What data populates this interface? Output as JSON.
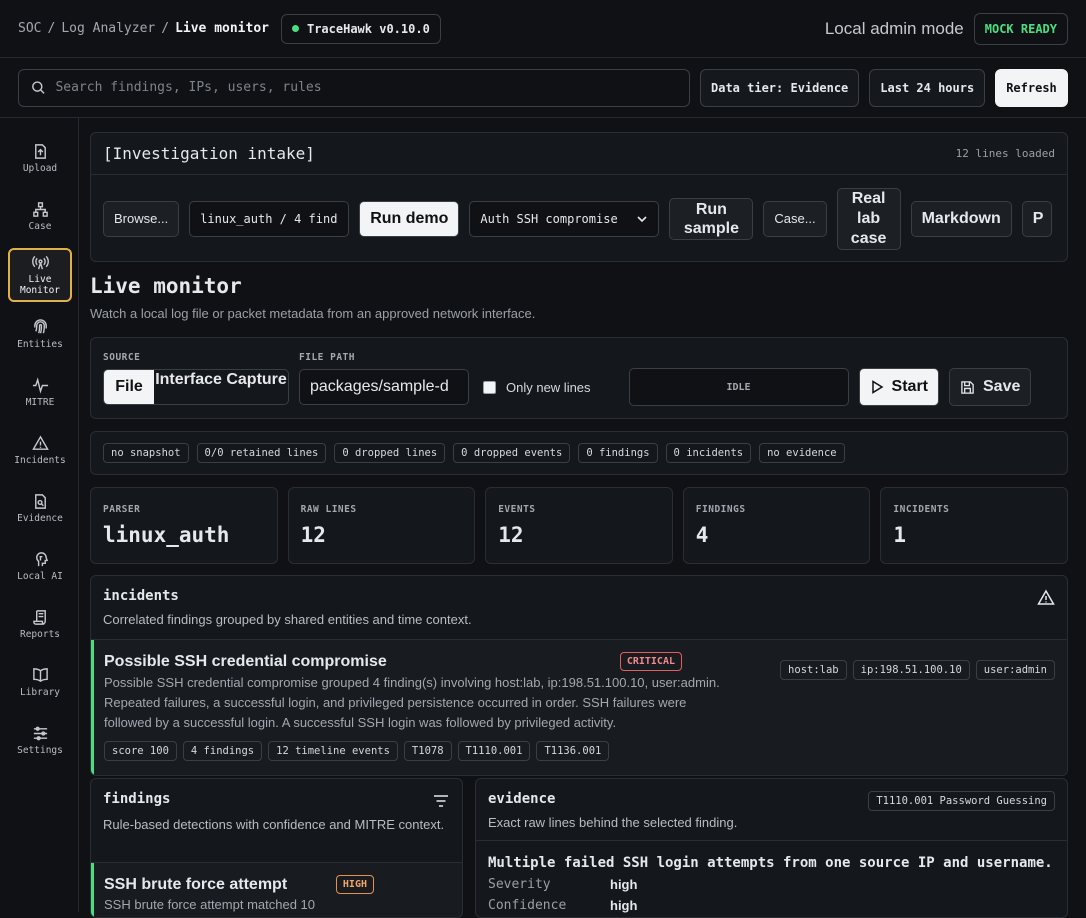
{
  "breadcrumb": {
    "soc": "SOC",
    "sep1": "/",
    "analyzer": "Log Analyzer",
    "sep2": "/",
    "current": "Live monitor"
  },
  "app_version": "TraceHawk v0.10.0",
  "mode_label": "Local admin mode",
  "mock_status": "MOCK READY",
  "search": {
    "placeholder": "Search findings, IPs, users, rules"
  },
  "toolbar": {
    "data_tier": "Data tier: Evidence",
    "time_range": "Last 24 hours",
    "refresh": "Refresh"
  },
  "sidebar": {
    "items": [
      {
        "label": "Upload",
        "icon": "upload-icon"
      },
      {
        "label": "Case",
        "icon": "case-icon"
      },
      {
        "label": "Live\nMonitor",
        "icon": "live-monitor-icon",
        "active": true
      },
      {
        "label": "Entities",
        "icon": "fingerprint-icon"
      },
      {
        "label": "MITRE",
        "icon": "pulse-icon"
      },
      {
        "label": "Incidents",
        "icon": "warning-icon"
      },
      {
        "label": "Evidence",
        "icon": "evidence-icon"
      },
      {
        "label": "Local AI",
        "icon": "brain-icon"
      },
      {
        "label": "Reports",
        "icon": "scroll-icon"
      },
      {
        "label": "Library",
        "icon": "book-icon"
      },
      {
        "label": "Settings",
        "icon": "sliders-icon"
      }
    ]
  },
  "intake": {
    "title": "[Investigation intake]",
    "lines_loaded": "12 lines loaded",
    "browse": "Browse...",
    "sample_field": "linux_auth / 4 find",
    "run_demo": "Run demo",
    "scenario": "Auth SSH compromise",
    "run_sample": "Run sample",
    "case": "Case...",
    "real_lab_case": "Real lab case",
    "markdown": "Markdown",
    "cut_button": "P"
  },
  "live_monitor": {
    "title": "Live monitor",
    "subtitle": "Watch a local log file or packet metadata from an approved network interface.",
    "source_label": "SOURCE",
    "source_file": "File",
    "source_interface": "Interface Capture",
    "file_path_label": "FILE PATH",
    "file_path_value": "packages/sample-d",
    "only_new_lines": "Only new lines",
    "status": "IDLE",
    "start": "Start",
    "save": "Save"
  },
  "status_chips": [
    "no snapshot",
    "0/0 retained lines",
    "0 dropped lines",
    "0 dropped events",
    "0 findings",
    "0 incidents",
    "no evidence"
  ],
  "stats": [
    {
      "label": "PARSER",
      "value": "linux_auth"
    },
    {
      "label": "RAW LINES",
      "value": "12"
    },
    {
      "label": "EVENTS",
      "value": "12"
    },
    {
      "label": "FINDINGS",
      "value": "4"
    },
    {
      "label": "INCIDENTS",
      "value": "1"
    }
  ],
  "incidents": {
    "title": "incidents",
    "subtitle": "Correlated findings grouped by shared entities and time context.",
    "item": {
      "title": "Possible SSH credential compromise",
      "severity": "CRITICAL",
      "description": "Possible SSH credential compromise grouped 4 finding(s) involving host:lab, ip:198.51.100.10, user:admin. Repeated failures, a successful login, and privileged persistence occurred in order. SSH failures were followed by a successful login. A successful SSH login was followed by privileged activity.",
      "entities": [
        "host:lab",
        "ip:198.51.100.10",
        "user:admin"
      ],
      "tags": [
        "score 100",
        "4 findings",
        "12 timeline events",
        "T1078",
        "T1110.001",
        "T1136.001"
      ]
    }
  },
  "findings": {
    "title": "findings",
    "subtitle": "Rule-based detections with confidence and MITRE context.",
    "item": {
      "title": "SSH brute force attempt",
      "severity": "HIGH",
      "description": "SSH brute force attempt matched 10"
    }
  },
  "evidence": {
    "title": "evidence",
    "subtitle": "Exact raw lines behind the selected finding.",
    "technique": "T1110.001 Password Guessing",
    "heading": "Multiple failed SSH login attempts from one source IP and username.",
    "severity_label": "Severity",
    "severity_value": "high",
    "confidence_label": "Confidence",
    "confidence_value": "high"
  }
}
